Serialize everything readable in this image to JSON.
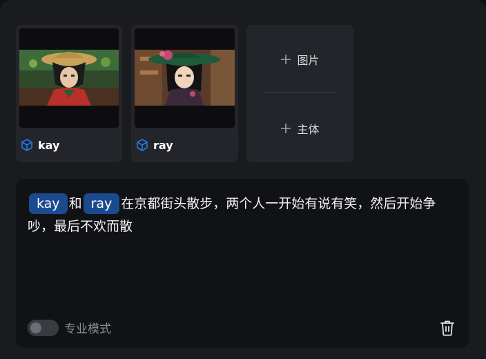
{
  "references": [
    {
      "name": "kay",
      "icon": "cube-icon"
    },
    {
      "name": "ray",
      "icon": "cube-icon"
    }
  ],
  "add_menu": {
    "image_label": "图片",
    "subject_label": "主体"
  },
  "prompt": {
    "tag_1": "kay",
    "connector": "和",
    "tag_2": "ray",
    "text": "在京都街头散步，两个人一开始有说有笑，然后开始争吵，最后不欢而散"
  },
  "footer": {
    "pro_mode_label": "专业模式",
    "pro_mode_enabled": false,
    "delete_icon": "trash-icon"
  },
  "colors": {
    "accent": "#1f7ce6",
    "tag_bg": "#1c4a8f",
    "panel_bg": "#1a1b1f",
    "card_bg": "#24252a"
  }
}
